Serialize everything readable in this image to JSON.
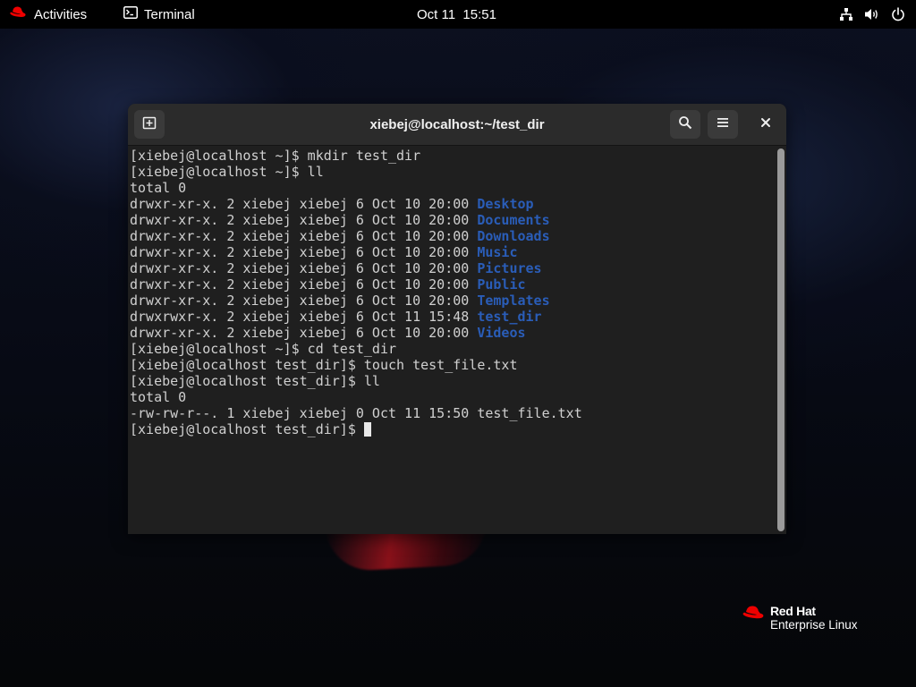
{
  "topbar": {
    "activities_label": "Activities",
    "app_name": "Terminal",
    "clock": "Oct 11  15:51",
    "icons": [
      "redhat-icon",
      "terminal-app-icon",
      "network-icon",
      "volume-icon",
      "power-icon"
    ]
  },
  "window": {
    "title": "xiebej@localhost:~/test_dir",
    "buttons": [
      "new-tab-icon",
      "search-icon",
      "hamburger-menu-icon",
      "close-icon"
    ]
  },
  "terminal": {
    "lines": [
      {
        "text": "[xiebej@localhost ~]$ mkdir test_dir"
      },
      {
        "text": "[xiebej@localhost ~]$ ll"
      },
      {
        "text": "total 0"
      },
      {
        "text": "drwxr-xr-x. 2 xiebej xiebej 6 Oct 10 20:00 ",
        "dir": "Desktop"
      },
      {
        "text": "drwxr-xr-x. 2 xiebej xiebej 6 Oct 10 20:00 ",
        "dir": "Documents"
      },
      {
        "text": "drwxr-xr-x. 2 xiebej xiebej 6 Oct 10 20:00 ",
        "dir": "Downloads"
      },
      {
        "text": "drwxr-xr-x. 2 xiebej xiebej 6 Oct 10 20:00 ",
        "dir": "Music"
      },
      {
        "text": "drwxr-xr-x. 2 xiebej xiebej 6 Oct 10 20:00 ",
        "dir": "Pictures"
      },
      {
        "text": "drwxr-xr-x. 2 xiebej xiebej 6 Oct 10 20:00 ",
        "dir": "Public"
      },
      {
        "text": "drwxr-xr-x. 2 xiebej xiebej 6 Oct 10 20:00 ",
        "dir": "Templates"
      },
      {
        "text": "drwxrwxr-x. 2 xiebej xiebej 6 Oct 11 15:48 ",
        "dir": "test_dir"
      },
      {
        "text": "drwxr-xr-x. 2 xiebej xiebej 6 Oct 10 20:00 ",
        "dir": "Videos"
      },
      {
        "text": "[xiebej@localhost ~]$ cd test_dir"
      },
      {
        "text": "[xiebej@localhost test_dir]$ touch test_file.txt"
      },
      {
        "text": "[xiebej@localhost test_dir]$ ll"
      },
      {
        "text": "total 0"
      },
      {
        "text": "-rw-rw-r--. 1 xiebej xiebej 0 Oct 11 15:50 test_file.txt"
      }
    ],
    "prompt": "[xiebej@localhost test_dir]$ ",
    "dir_color": "#2a5db8",
    "text_color": "#d0d0d0",
    "background": "#1f1f1f"
  },
  "branding": {
    "brand": "Red Hat",
    "product": "Enterprise Linux",
    "accent": "#ee0000"
  }
}
